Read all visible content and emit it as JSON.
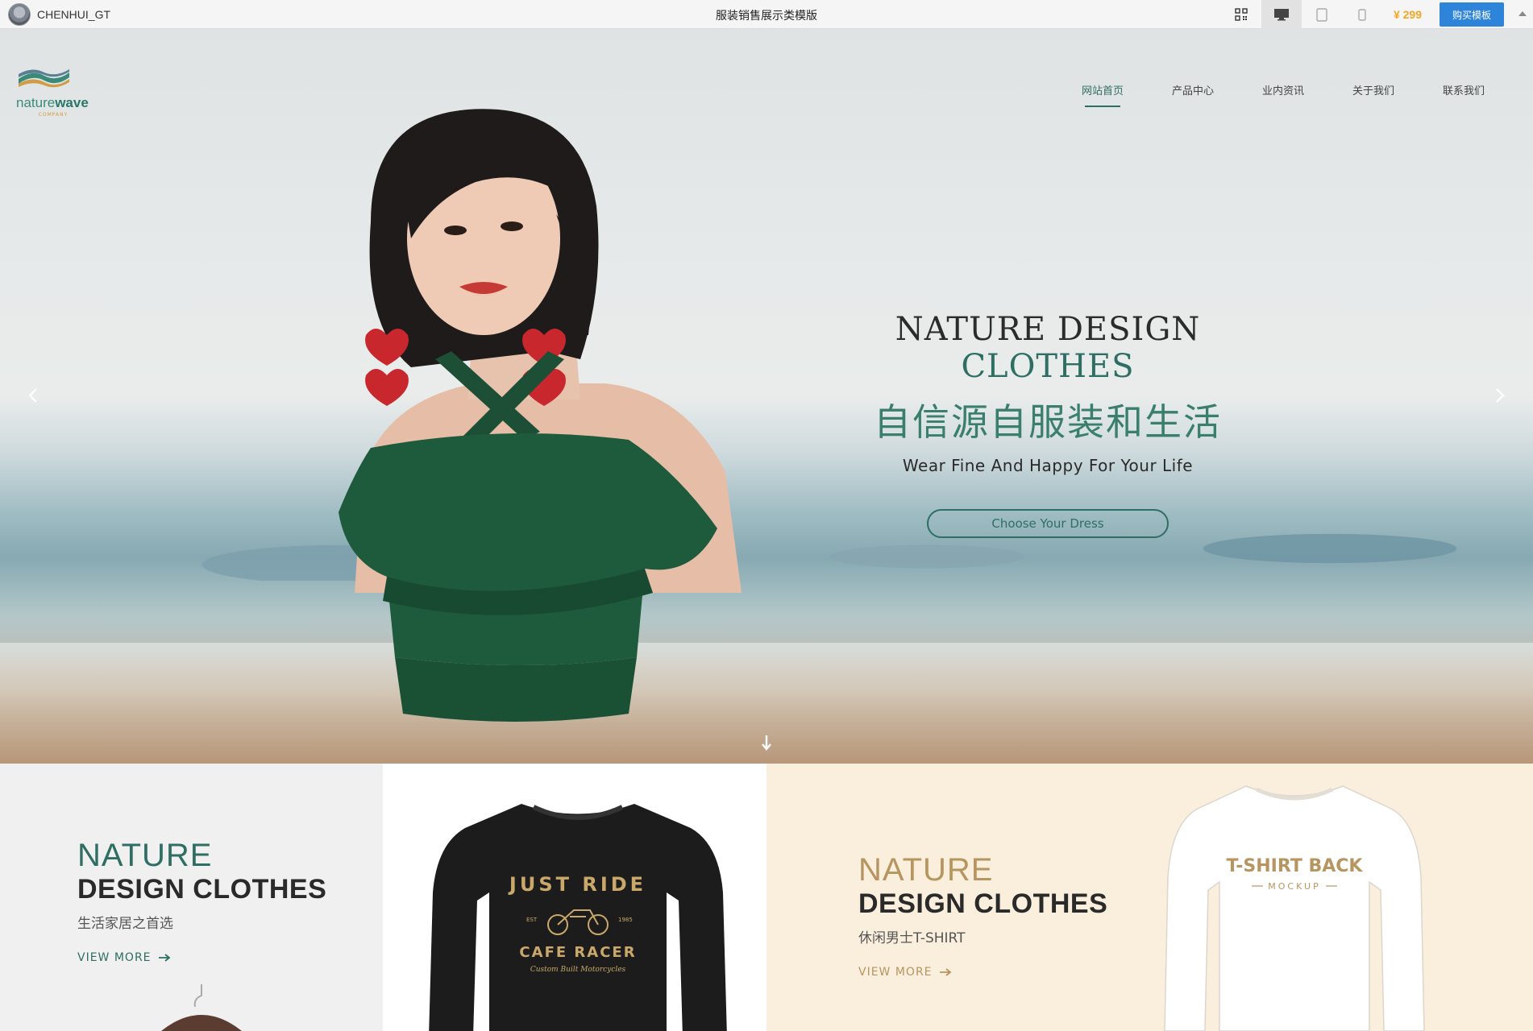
{
  "toolbar": {
    "brand_name": "CHENHUI_GT",
    "title": "服装销售展示类模版",
    "price": "¥ 299",
    "buy_label": "购买模板"
  },
  "site": {
    "logo_text_light": "nature",
    "logo_text_bold": "wave",
    "logo_company": "COMPANY",
    "nav": [
      {
        "label": "网站首页",
        "active": true
      },
      {
        "label": "产品中心"
      },
      {
        "label": "业内资讯"
      },
      {
        "label": "关于我们"
      },
      {
        "label": "联系我们"
      }
    ]
  },
  "hero": {
    "title_main": "NATURE DESIGN ",
    "title_accent": "CLOTHES",
    "title_cn": "自信源自服装和生活",
    "subtitle": "Wear Fine And Happy For Your Life",
    "button": "Choose Your Dress"
  },
  "products": {
    "card1": {
      "title_light": "NATURE",
      "title_bold": "DESIGN CLOTHES",
      "subtitle": "生活家居之首选",
      "link": "VIEW  MORE"
    },
    "card2": {
      "shirt_line1": "JUST RIDE",
      "shirt_line2": "CAFE RACER",
      "shirt_line3": "Custom Built Motorcycles",
      "shirt_est": "EST",
      "shirt_year": "1985"
    },
    "card3": {
      "title_light": "NATURE",
      "title_bold": "DESIGN CLOTHES",
      "subtitle": "休闲男士T-SHIRT",
      "link": "VIEW  MORE",
      "shirt_line1": "T-SHIRT BACK",
      "shirt_line2": "MOCKUP"
    }
  },
  "colors": {
    "accent_green": "#2f6e63",
    "gold": "#b79560",
    "buy_blue": "#2d84d8",
    "price_orange": "#f5a623"
  }
}
